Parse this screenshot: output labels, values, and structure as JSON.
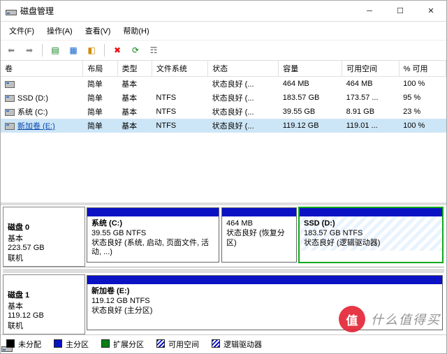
{
  "window": {
    "title": "磁盘管理"
  },
  "menubar": {
    "file": "文件(F)",
    "action": "操作(A)",
    "view": "查看(V)",
    "help": "帮助(H)"
  },
  "table": {
    "headers": [
      "卷",
      "布局",
      "类型",
      "文件系统",
      "状态",
      "容量",
      "可用空间",
      "% 可用"
    ],
    "rows": [
      {
        "name": "",
        "layout": "简单",
        "type": "基本",
        "fs": "",
        "status": "状态良好 (...",
        "capacity": "464 MB",
        "free": "464 MB",
        "pct": "100 %"
      },
      {
        "name": "SSD  (D:)",
        "layout": "简单",
        "type": "基本",
        "fs": "NTFS",
        "status": "状态良好 (...",
        "capacity": "183.57 GB",
        "free": "173.57 ...",
        "pct": "95 %"
      },
      {
        "name": "系统 (C:)",
        "layout": "简单",
        "type": "基本",
        "fs": "NTFS",
        "status": "状态良好 (...",
        "capacity": "39.55 GB",
        "free": "8.91 GB",
        "pct": "23 %"
      },
      {
        "name": "新加卷 (E:)",
        "layout": "简单",
        "type": "基本",
        "fs": "NTFS",
        "status": "状态良好 (...",
        "capacity": "119.12 GB",
        "free": "119.01 ...",
        "pct": "100 %",
        "selected": true
      }
    ]
  },
  "disks": {
    "d0": {
      "label": "磁盘 0",
      "type": "基本",
      "size": "223.57 GB",
      "status": "联机"
    },
    "d1": {
      "label": "磁盘 1",
      "type": "基本",
      "size": "119.12 GB",
      "status": "联机"
    }
  },
  "parts": {
    "p_c": {
      "title": "系统  (C:)",
      "line2": "39.55 GB NTFS",
      "line3": "状态良好 (系统, 启动, 页面文件, 活动, ...)"
    },
    "p_rec": {
      "title": "",
      "line2": "464 MB",
      "line3": "状态良好 (恢复分区)"
    },
    "p_d": {
      "title": "SSD  (D:)",
      "line2": "183.57 GB NTFS",
      "line3": "状态良好 (逻辑驱动器)"
    },
    "p_e": {
      "title": "新加卷  (E:)",
      "line2": "119.12 GB NTFS",
      "line3": "状态良好 (主分区)"
    }
  },
  "legend": {
    "unalloc": "未分配",
    "primary": "主分区",
    "ext": "扩展分区",
    "free": "可用空间",
    "logical": "逻辑驱动器"
  },
  "watermark": {
    "badge": "值",
    "text": "什么值得买"
  }
}
